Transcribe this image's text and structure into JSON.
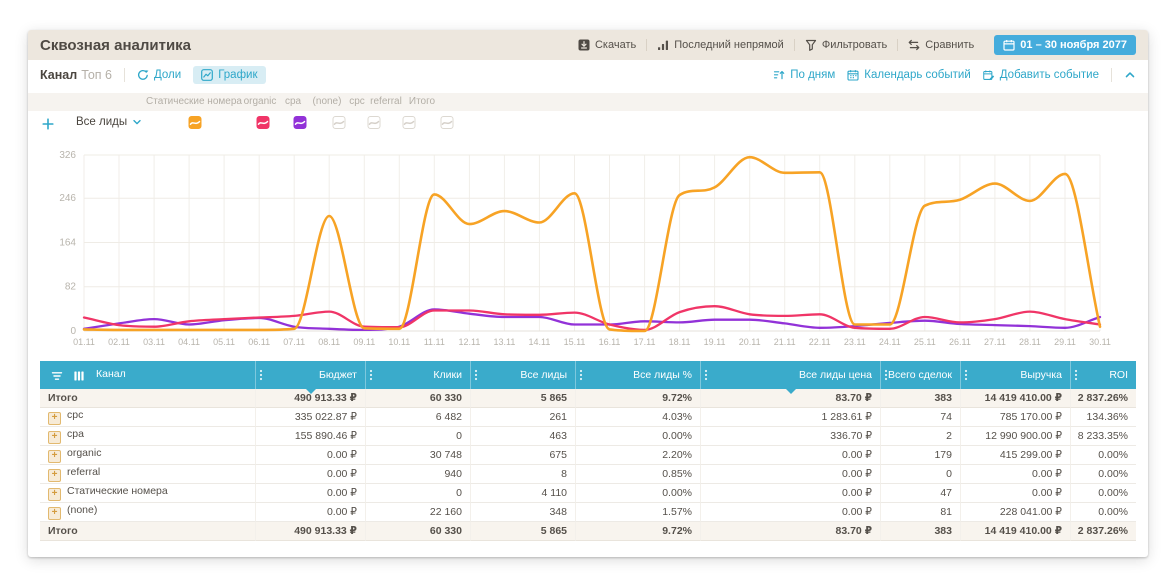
{
  "header": {
    "title": "Сквозная аналитика",
    "actions": [
      {
        "id": "download",
        "label": "Скачать",
        "icon": "download-icon"
      },
      {
        "id": "attribution",
        "label": "Последний непрямой",
        "icon": "bar-chart-icon"
      },
      {
        "id": "filter",
        "label": "Фильтровать",
        "icon": "filter-icon"
      },
      {
        "id": "compare",
        "label": "Сравнить",
        "icon": "compare-icon"
      }
    ],
    "date_range": {
      "label": "01 – 30 ноября 2077",
      "icon": "calendar-icon"
    }
  },
  "toolbar": {
    "dimension_label": "Канал",
    "dimension_sub": "Топ 6",
    "share_label": "Доли",
    "chart_label": "График",
    "right": [
      {
        "id": "by-days",
        "label": "По дням",
        "icon": "sort-days-icon"
      },
      {
        "id": "events-calendar",
        "label": "Календарь событий",
        "icon": "calendar-grid-icon"
      },
      {
        "id": "add-event",
        "label": "Добавить событие",
        "icon": "calendar-add-icon"
      }
    ]
  },
  "legend": {
    "metric_label": "Все лиды",
    "series": [
      {
        "label": "Статические номера",
        "color": "#F7A325",
        "active": true
      },
      {
        "label": "organic",
        "color": "#F03567",
        "active": true
      },
      {
        "label": "cpa",
        "color": "#9232D8",
        "active": true
      },
      {
        "label": "(none)",
        "color": null,
        "active": false
      },
      {
        "label": "cpc",
        "color": null,
        "active": false
      },
      {
        "label": "referral",
        "color": null,
        "active": false
      },
      {
        "label": "Итого",
        "color": null,
        "active": false
      }
    ]
  },
  "chart_data": {
    "type": "line",
    "title": "Все лиды по каналам по дням",
    "x": [
      "01.11",
      "02.11",
      "03.11",
      "04.11",
      "05.11",
      "06.11",
      "07.11",
      "08.11",
      "09.11",
      "10.11",
      "11.11",
      "12.11",
      "13.11",
      "14.11",
      "15.11",
      "16.11",
      "17.11",
      "18.11",
      "19.11",
      "20.11",
      "21.11",
      "22.11",
      "23.11",
      "24.11",
      "25.11",
      "26.11",
      "27.11",
      "28.11",
      "29.11",
      "30.11"
    ],
    "ylim": [
      0,
      326
    ],
    "yticks": [
      0,
      82,
      164,
      246,
      326
    ],
    "grid": true,
    "series": [
      {
        "name": "Статические номера",
        "color": "#F7A325",
        "values": [
          3,
          2,
          2,
          2,
          2,
          2,
          4,
          213,
          5,
          4,
          253,
          198,
          222,
          201,
          255,
          3,
          0,
          252,
          266,
          322,
          293,
          294,
          12,
          12,
          232,
          243,
          273,
          241,
          291,
          8
        ]
      },
      {
        "name": "organic",
        "color": "#F03567",
        "values": [
          25,
          11,
          8,
          18,
          22,
          25,
          28,
          36,
          8,
          7,
          38,
          38,
          31,
          30,
          34,
          12,
          2,
          35,
          46,
          31,
          28,
          31,
          6,
          4,
          26,
          16,
          22,
          36,
          22,
          12
        ]
      },
      {
        "name": "cpa",
        "color": "#9232D8",
        "values": [
          4,
          14,
          22,
          12,
          20,
          24,
          8,
          4,
          2,
          8,
          40,
          32,
          26,
          26,
          12,
          12,
          18,
          16,
          21,
          21,
          14,
          6,
          9,
          15,
          19,
          13,
          11,
          9,
          6,
          26
        ]
      }
    ]
  },
  "table": {
    "columns": [
      "Канал",
      "Бюджет",
      "Клики",
      "Все лиды",
      "Все лиды %",
      "Все лиды цена",
      "Всего сделок",
      "Выручка",
      "ROI"
    ],
    "sorted_columns": [
      "Бюджет",
      "Все лиды цена"
    ],
    "rows": [
      {
        "name": "Итого",
        "type": "total",
        "values": [
          "490 913.33 ₽",
          "60 330",
          "5 865",
          "9.72%",
          "83.70 ₽",
          "383",
          "14 419 410.00 ₽",
          "2 837.26%"
        ]
      },
      {
        "name": "cpc",
        "type": "channel",
        "values": [
          "335 022.87 ₽",
          "6 482",
          "261",
          "4.03%",
          "1 283.61 ₽",
          "74",
          "785 170.00 ₽",
          "134.36%"
        ]
      },
      {
        "name": "cpa",
        "type": "channel",
        "values": [
          "155 890.46 ₽",
          "0",
          "463",
          "0.00%",
          "336.70 ₽",
          "2",
          "12 990 900.00 ₽",
          "8 233.35%"
        ]
      },
      {
        "name": "organic",
        "type": "channel",
        "values": [
          "0.00 ₽",
          "30 748",
          "675",
          "2.20%",
          "0.00 ₽",
          "179",
          "415 299.00 ₽",
          "0.00%"
        ]
      },
      {
        "name": "referral",
        "type": "channel",
        "values": [
          "0.00 ₽",
          "940",
          "8",
          "0.85%",
          "0.00 ₽",
          "0",
          "0.00 ₽",
          "0.00%"
        ]
      },
      {
        "name": "Статические номера",
        "type": "channel",
        "values": [
          "0.00 ₽",
          "0",
          "4 110",
          "0.00%",
          "0.00 ₽",
          "47",
          "0.00 ₽",
          "0.00%"
        ]
      },
      {
        "name": "(none)",
        "type": "channel",
        "values": [
          "0.00 ₽",
          "22 160",
          "348",
          "1.57%",
          "0.00 ₽",
          "81",
          "228 041.00 ₽",
          "0.00%"
        ]
      },
      {
        "name": "Итого",
        "type": "total",
        "values": [
          "490 913.33 ₽",
          "60 330",
          "5 865",
          "9.72%",
          "83.70 ₽",
          "383",
          "14 419 410.00 ₽",
          "2 837.26%"
        ]
      }
    ]
  },
  "colors": {
    "accent_teal": "#2EA7C9",
    "table_header": "#3AABCB",
    "date_button": "#45ACDC",
    "title_band": "#EDE7DE"
  }
}
